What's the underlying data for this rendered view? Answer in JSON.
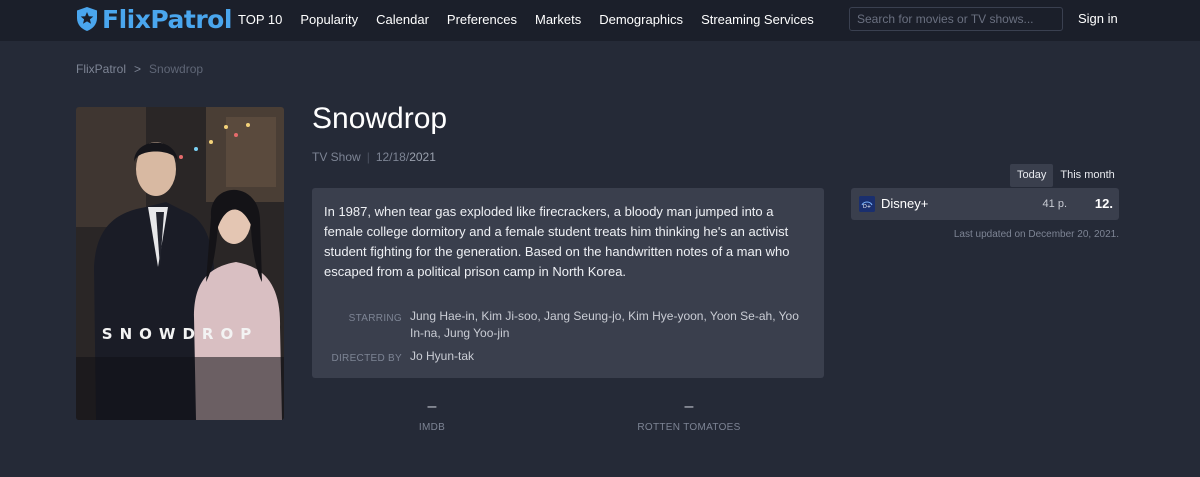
{
  "header": {
    "brand": "FlixPatrol",
    "nav": [
      "TOP 10",
      "Popularity",
      "Calendar",
      "Preferences",
      "Markets",
      "Demographics",
      "Streaming Services"
    ],
    "search_placeholder": "Search for movies or TV shows...",
    "signin": "Sign in",
    "brand_color": "#4aa6ee"
  },
  "breadcrumb": {
    "home": "FlixPatrol",
    "separator": ">",
    "current": "Snowdrop"
  },
  "poster": {
    "title_text": "SNOWDROP"
  },
  "show": {
    "title": "Snowdrop",
    "type": "TV Show",
    "date_part1": "12/18/",
    "date_part2": "2021",
    "description": "In 1987, when tear gas exploded like firecrackers, a bloody man jumped into a female college dormitory and a female student treats him thinking he's an activist student fighting for the generation. Based on the handwritten notes of a man who escaped from a political prison camp in North Korea.",
    "starring_label": "STARRING",
    "starring": "Jung Hae-in, Kim Ji-soo, Jang Seung-jo, Kim Hye-yoon, Yoon Se-ah, Yoo In-na, Jung Yoo-jin",
    "directed_label": "DIRECTED BY",
    "director": "Jo Hyun-tak"
  },
  "ratings": [
    {
      "value": "–",
      "label": "IMDB"
    },
    {
      "value": "–",
      "label": "ROTTEN TOMATOES"
    }
  ],
  "rankings": {
    "tabs": [
      "Today",
      "This month"
    ],
    "active_tab": "Today",
    "services": [
      {
        "name": "Disney+",
        "points": "41 p.",
        "rank": "12.",
        "logo_color": "#1a2f6e"
      }
    ],
    "updated": "Last updated on December 20, 2021."
  }
}
